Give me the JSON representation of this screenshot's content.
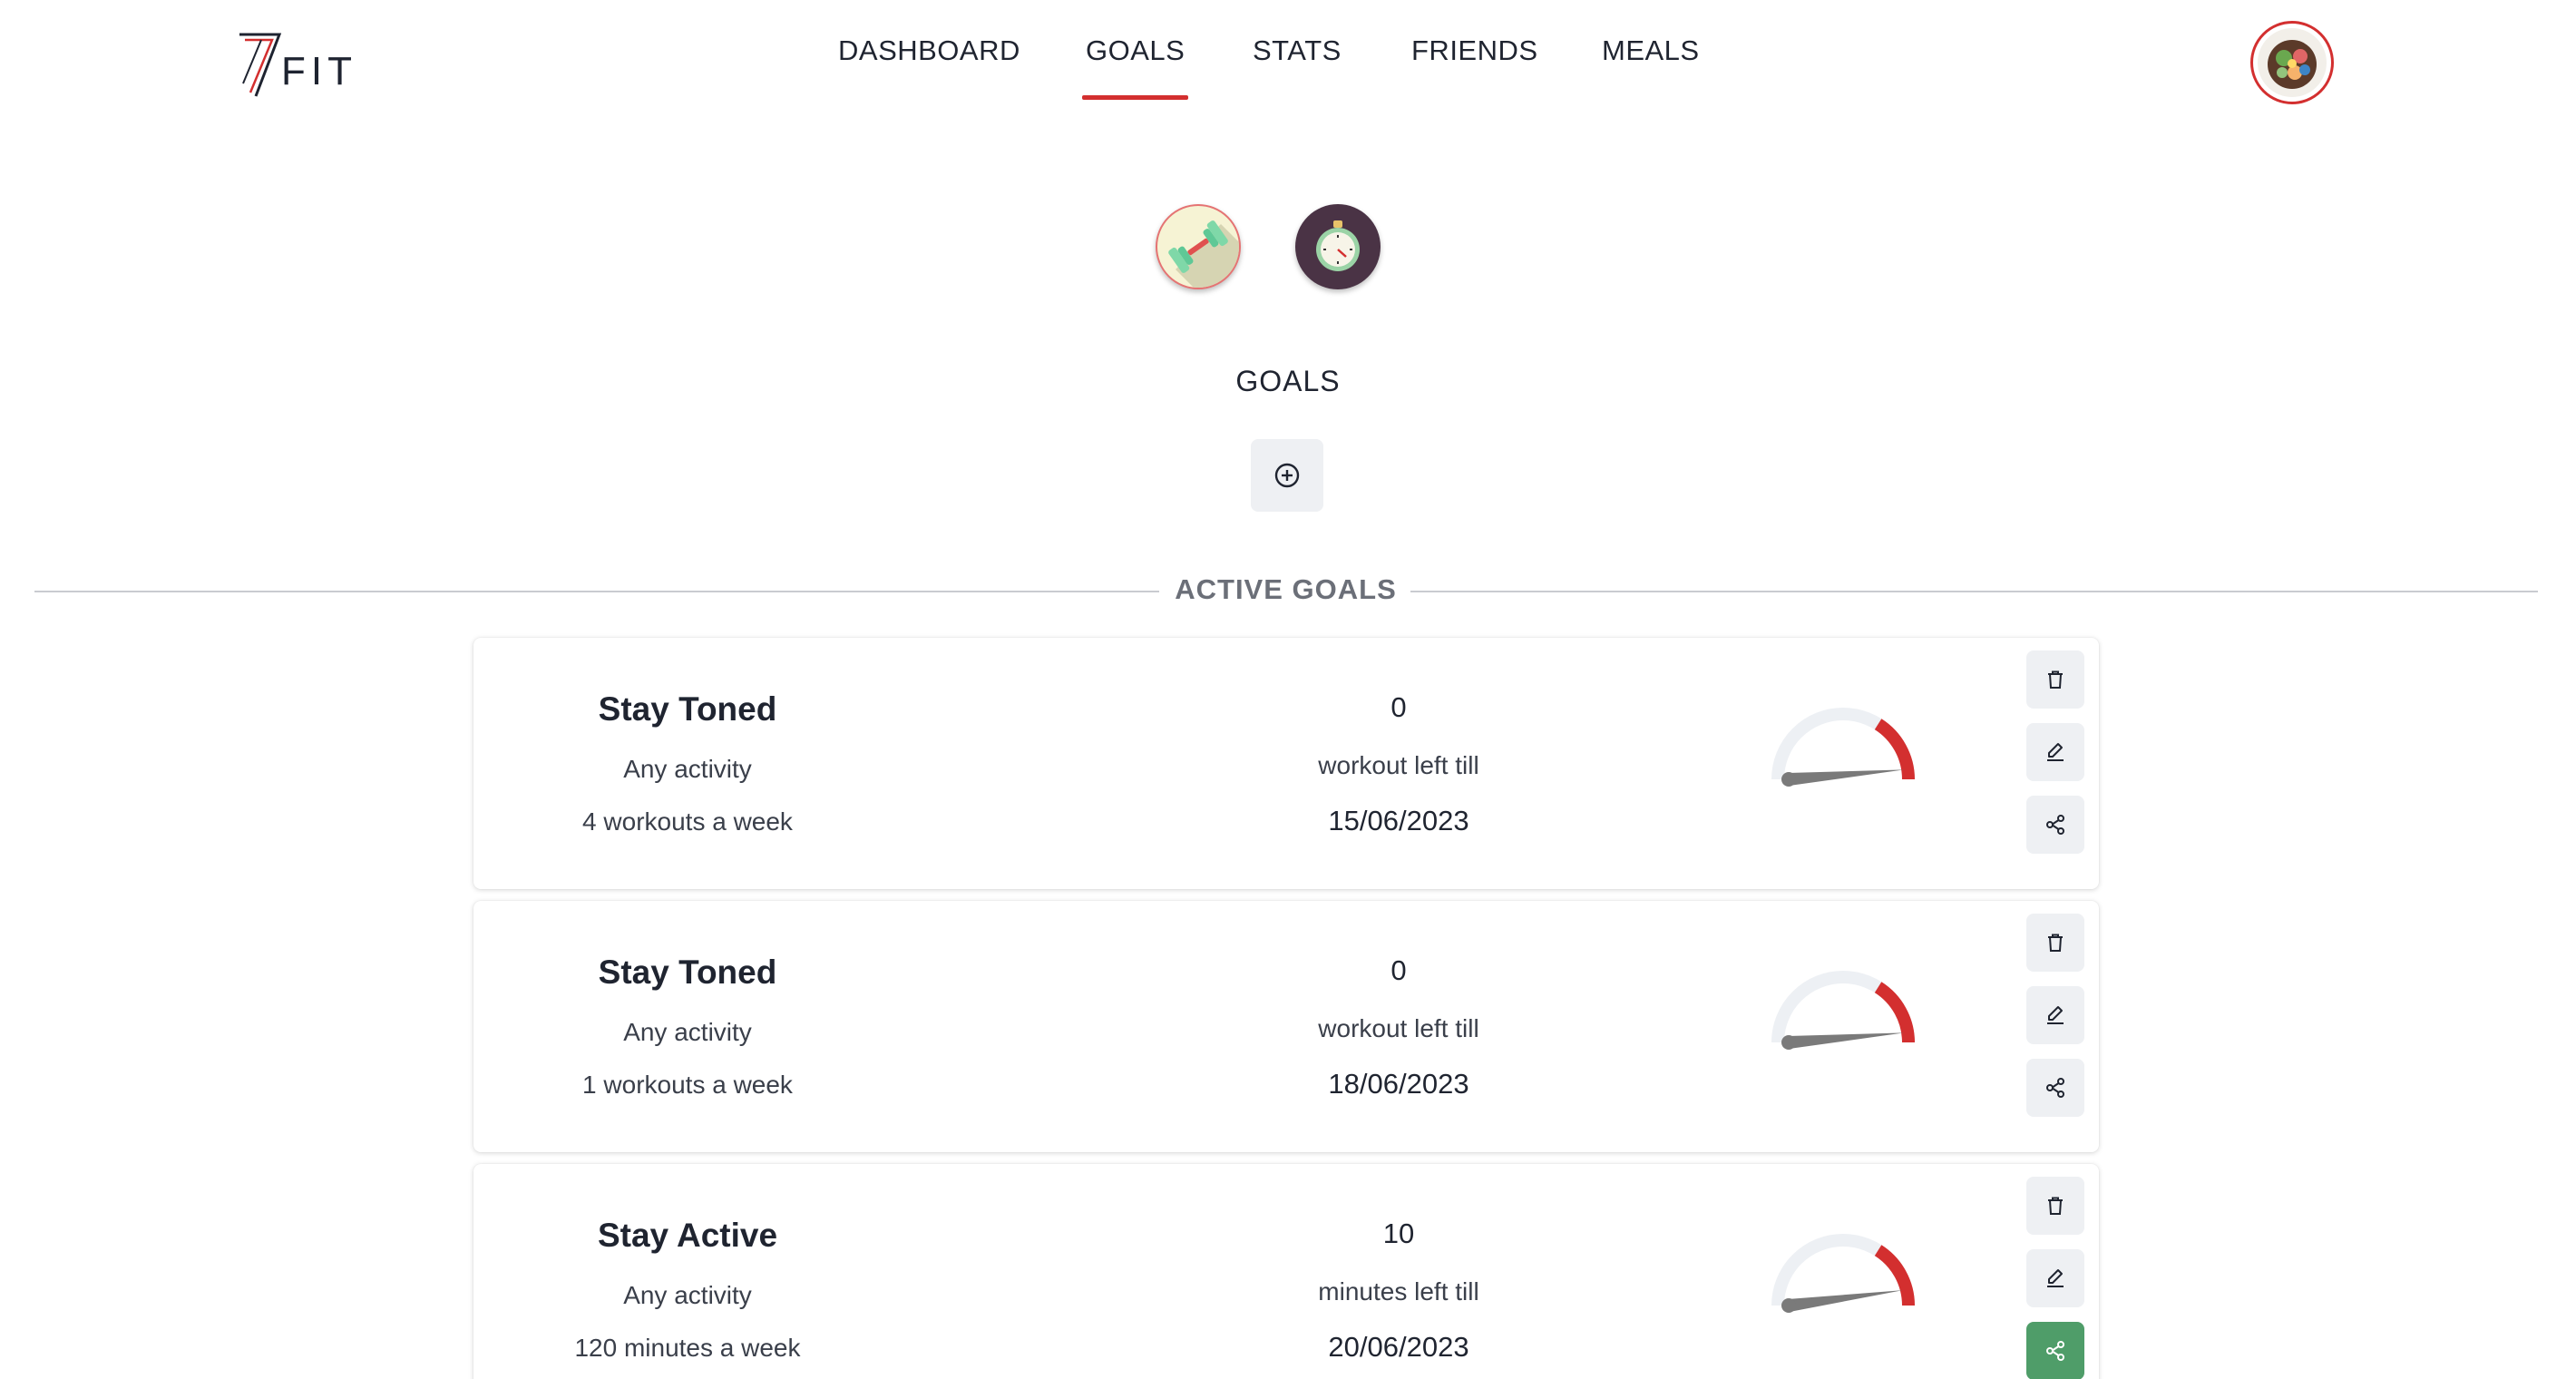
{
  "brand": {
    "logo_text": "FIT",
    "accent_color": "#d32f2f"
  },
  "nav": {
    "items": [
      {
        "label": "DASHBOARD",
        "active": false
      },
      {
        "label": "GOALS",
        "active": true
      },
      {
        "label": "STATS",
        "active": false
      },
      {
        "label": "FRIENDS",
        "active": false
      },
      {
        "label": "MEALS",
        "active": false
      }
    ]
  },
  "user": {
    "avatar": "user-avatar-salad-bowl"
  },
  "modes": [
    {
      "name": "strength",
      "icon": "dumbbell-icon",
      "selected": true
    },
    {
      "name": "cardio",
      "icon": "stopwatch-icon",
      "selected": false
    }
  ],
  "goals_section": {
    "title": "GOALS",
    "add_icon": "plus-circle-icon"
  },
  "active_goals": {
    "label": "ACTIVE GOALS",
    "cards": [
      {
        "title": "Stay Toned",
        "activity": "Any activity",
        "frequency": "4 workouts a week",
        "count": "0",
        "left_label": "workout left till",
        "date": "15/06/2023",
        "gauge_level": 0.95,
        "shared": false
      },
      {
        "title": "Stay Toned",
        "activity": "Any activity",
        "frequency": "1 workouts a week",
        "count": "0",
        "left_label": "workout left till",
        "date": "18/06/2023",
        "gauge_level": 0.95,
        "shared": false
      },
      {
        "title": "Stay Active",
        "activity": "Any activity",
        "frequency": "120 minutes a week",
        "count": "10",
        "left_label": "minutes left till",
        "date": "20/06/2023",
        "gauge_level": 0.92,
        "shared": true
      }
    ]
  },
  "colors": {
    "gauge_track": "#edf0f4",
    "gauge_fill": "#d32f2f",
    "gauge_needle": "#7a7a7a",
    "button_bg": "#eef0f3",
    "shared_button_bg": "#4f9d69"
  }
}
